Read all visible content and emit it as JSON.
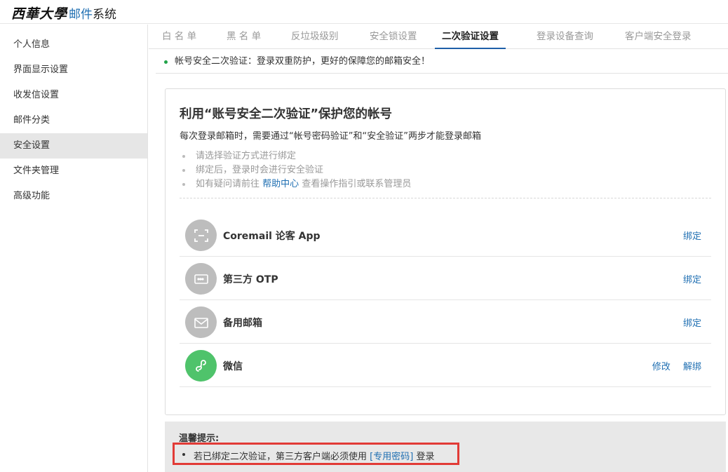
{
  "logo": {
    "school": "西華大學",
    "mail": "邮件",
    "system": "系统"
  },
  "sidebar": {
    "items": [
      {
        "label": "个人信息"
      },
      {
        "label": "界面显示设置"
      },
      {
        "label": "收发信设置"
      },
      {
        "label": "邮件分类"
      },
      {
        "label": "安全设置",
        "active": true
      },
      {
        "label": "文件夹管理"
      },
      {
        "label": "高级功能"
      }
    ]
  },
  "tabs": [
    {
      "label": "白 名 单"
    },
    {
      "label": "黑 名 单"
    },
    {
      "label": "反垃圾级别"
    },
    {
      "label": "安全锁设置"
    },
    {
      "label": "二次验证设置",
      "active": true
    },
    {
      "label": "登录设备查询"
    },
    {
      "label": "客户端安全登录"
    }
  ],
  "notice": {
    "text": "帐号安全二次验证：登录双重防护，更好的保障您的邮箱安全！"
  },
  "card": {
    "title": "利用“账号安全二次验证”保护您的帐号",
    "description": "每次登录邮箱时，需要通过“帐号密码验证”和“安全验证”两步才能登录邮箱",
    "tips": {
      "tip1": "请选择验证方式进行绑定",
      "tip2": "绑定后，登录时会进行安全验证",
      "tip3_prefix": "如有疑问请前往",
      "tip3_link": "帮助中心",
      "tip3_suffix": "查看操作指引或联系管理员"
    },
    "methods": [
      {
        "name": "Coremail 论客 App",
        "icon": "scan-icon",
        "action": "绑定"
      },
      {
        "name": "第三方 OTP",
        "icon": "password-card-icon",
        "action": "绑定"
      },
      {
        "name": "备用邮箱",
        "icon": "envelope-icon",
        "action": "绑定"
      },
      {
        "name": "微信",
        "icon": "wechat-mini-program-icon",
        "action_modify": "修改",
        "action_unbind": "解绑"
      }
    ]
  },
  "warm_tip": {
    "title": "温馨提示:",
    "prefix": "若已绑定二次验证，第三方客户端必须使用",
    "link": "[专用密码]",
    "suffix": "登录"
  },
  "colors": {
    "accent": "#1f6fb2",
    "active_tab_underline": "#1e5fa8",
    "wechat_green": "#4fc36b",
    "highlight_border": "#e23b36",
    "notice_dot": "#21a34a"
  }
}
